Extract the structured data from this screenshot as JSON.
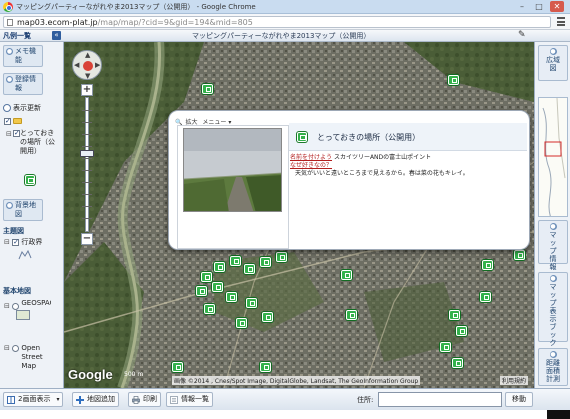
{
  "window": {
    "title": "マッピングパーティーながれやま2013マップ（公開用） - Google Chrome",
    "minimize": "–",
    "maximize": "□",
    "close": "✕"
  },
  "address": {
    "url_host": "map03.ecom-plat.jp",
    "url_path": "/map/map/?cid=9&gid=194&mid=805"
  },
  "header": {
    "legend_title": "凡例一覧",
    "collapse": "«",
    "map_title": "マッピングパーティーながれやま2013マップ（公開用）"
  },
  "left_panel": {
    "memo_button": "メモ機能",
    "register_button": "登録情報",
    "update_label": "表示更新",
    "layer_name": "とっておきの場所（公開用）",
    "background_button": "背景地図",
    "theme_title": "主題図",
    "admin_label": "行政界",
    "base_title": "基本地図",
    "geosp_label": "GEOSPACE地図",
    "osm_label": "Open Street Map"
  },
  "map": {
    "zoom_in": "+",
    "zoom_out": "−",
    "google": "Google",
    "scale": "500 m",
    "copyright": "画像 ©2014 , Cnes/Spot Image, DigitalGlobe, Landsat, The GeoInformation Group",
    "terms": "利用規約"
  },
  "info_window": {
    "zoom_link": "拡大",
    "menu_link": "メニュー ▾",
    "place_name": "とっておきの場所（公開用）",
    "field1_label": "名前を付けよう",
    "field1_value": "スカイツリーANDの富士山ポイント",
    "field2_label": "なぜ好きなの？",
    "field2_value": "天気がいいと遠いところまで見えるから。春は菜の花もキレイ。"
  },
  "right_panel": {
    "overview_button": "広域図",
    "map_info_button": "マップ情報",
    "bookmark_button": "マップ表示ブックマーク",
    "area_button": "距離面積計測"
  },
  "bottom_bar": {
    "dual_view": "2画面表示",
    "add_map": "地図追加",
    "print": "印刷",
    "info_list": "情報一覧",
    "address_label": "住所:",
    "move_button": "移動"
  }
}
